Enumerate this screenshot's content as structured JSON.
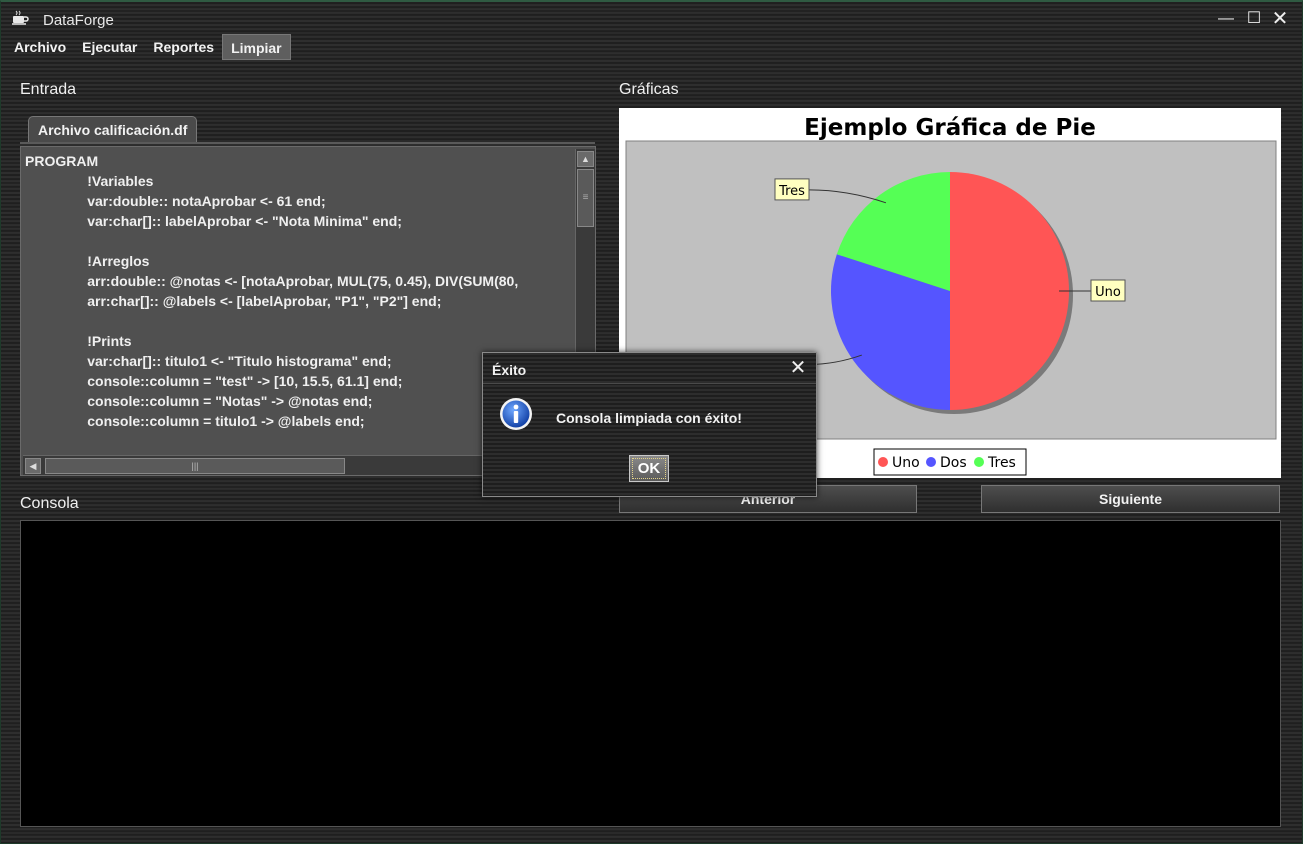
{
  "window": {
    "title": "DataForge",
    "app_icon": "coffee-cup-icon",
    "minimize": "—",
    "maximize": "☐",
    "close": "✕"
  },
  "menu": [
    "Archivo",
    "Ejecutar",
    "Reportes",
    "Limpiar"
  ],
  "entrada": {
    "label": "Entrada",
    "tab": "Archivo calificación.df",
    "code_lines": [
      "PROGRAM",
      "                !Variables",
      "                var:double:: notaAprobar <- 61 end;",
      "                var:char[]:: labelAprobar <- \"Nota Minima\" end;",
      "",
      "                !Arreglos",
      "                arr:double:: @notas <- [notaAprobar, MUL(75, 0.45), DIV(SUM(80,",
      "                arr:char[]:: @labels <- [labelAprobar, \"P1\", \"P2\"] end;",
      "",
      "                !Prints",
      "                var:char[]:: titulo1 <- \"Titulo histograma\" end;",
      "                console::column = \"test\" -> [10, 15.5, 61.1] end;",
      "                console::column = \"Notas\" -> @notas end;",
      "                console::column = titulo1 -> @labels end;"
    ]
  },
  "graficas": {
    "label": "Gráficas",
    "chart_data": {
      "type": "pie",
      "title": "Ejemplo Gráfica de Pie",
      "categories": [
        "Uno",
        "Dos",
        "Tres"
      ],
      "values": [
        50,
        30,
        20
      ],
      "colors": [
        "#ff5555",
        "#5555ff",
        "#55ff55"
      ],
      "legend": "bottom",
      "plot_background": "#c0c0c0"
    }
  },
  "buttons": {
    "anterior": "Anterior",
    "siguiente": "Siguiente"
  },
  "consola": {
    "label": "Consola",
    "content": ""
  },
  "dialog": {
    "title": "Éxito",
    "message": "Consola limpiada con éxito!",
    "ok": "OK",
    "icon": "info-icon",
    "close": "✕"
  }
}
